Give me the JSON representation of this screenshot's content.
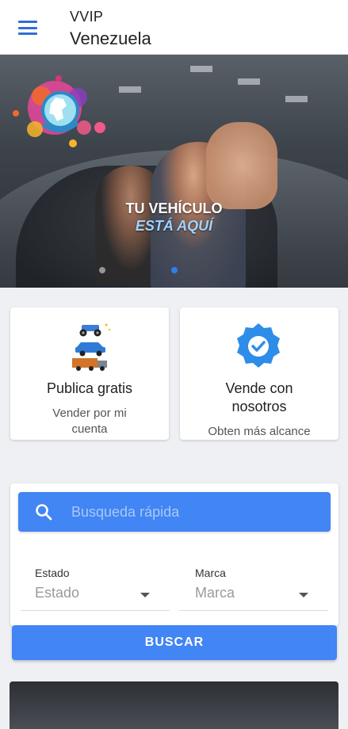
{
  "appbar": {
    "title_line1": "VVIP",
    "title_line2": "Venezuela"
  },
  "banner": {
    "headline": "TU VEHÍCULO",
    "subheadline": "ESTÁ AQUÍ",
    "active_slide": 2,
    "slide_count": 2
  },
  "cards": {
    "publica": {
      "title": "Publica gratis",
      "subtitle_line1": "Vender por mi",
      "subtitle_line2": "cuenta"
    },
    "vende": {
      "title_line1": "Vende con",
      "title_line2": "nosotros",
      "subtitle": "Obten más alcance"
    }
  },
  "search": {
    "placeholder": "Busqueda rápida",
    "estado": {
      "label": "Estado",
      "value": "Estado"
    },
    "marca": {
      "label": "Marca",
      "value": "Marca"
    },
    "button_label": "BUSCAR"
  },
  "colors": {
    "accent": "#4285f4",
    "menu_icon": "#2f6fd6",
    "badge": "#2d8de8",
    "banner_subheadline": "#9fd3ff"
  },
  "icons": {
    "menu": "hamburger-icon",
    "search": "search-icon",
    "dropdown": "caret-down-icon",
    "verified": "verified-badge-icon",
    "vehicles": "vehicles-illustration"
  }
}
